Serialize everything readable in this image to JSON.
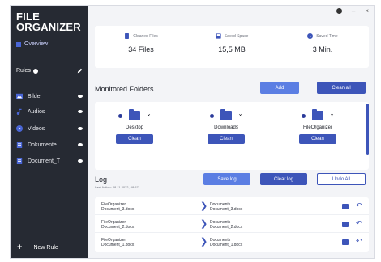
{
  "app": {
    "title_line1": "FILE",
    "title_line2": "ORGANIZER"
  },
  "sidebar": {
    "overview": "Overview",
    "rules_label": "Rules",
    "items": [
      {
        "label": "Bilder",
        "icon": "image-icon"
      },
      {
        "label": "Audios",
        "icon": "music-icon"
      },
      {
        "label": "Videos",
        "icon": "play-icon"
      },
      {
        "label": "Dokumente",
        "icon": "document-icon"
      },
      {
        "label": "Document_T",
        "icon": "document-icon"
      }
    ],
    "new_rule": "New Rule"
  },
  "window_controls": {
    "minimize": "–",
    "close": "×"
  },
  "stats": [
    {
      "label": "Cleaned Files",
      "value": "34 Files",
      "icon": "file-icon"
    },
    {
      "label": "Saved Space",
      "value": "15,5 MB",
      "icon": "disk-icon"
    },
    {
      "label": "Saved Time",
      "value": "3 Min.",
      "icon": "clock-icon"
    }
  ],
  "monitored": {
    "title": "Monitored Folders",
    "add_label": "Add",
    "clean_all_label": "Clean all",
    "folders": [
      {
        "name": "Desktop",
        "clean_label": "Clean"
      },
      {
        "name": "Downloads",
        "clean_label": "Clean"
      },
      {
        "name": "FileOrganizer",
        "clean_label": "Clean"
      }
    ]
  },
  "log": {
    "title": "Log",
    "subtitle": "Last Action: 28.11.2022, 08:57",
    "save_label": "Save log",
    "clear_label": "Clear log",
    "undo_all_label": "Undo All",
    "rows": [
      {
        "src1": "FileOrganizer",
        "src2": "Document_3.docx",
        "dst1": "Documents",
        "dst2": "Document_3.docx"
      },
      {
        "src1": "FileOrganizer",
        "src2": "Document_2.docx",
        "dst1": "Documents",
        "dst2": "Document_2.docx"
      },
      {
        "src1": "FileOrganizer",
        "src2": "Document_1.docx",
        "dst1": "Documents",
        "dst2": "Document_1.docx"
      }
    ]
  },
  "colors": {
    "sidebar": "#262a33",
    "accent": "#3d55b9",
    "accent_light": "#5b7ee3"
  }
}
